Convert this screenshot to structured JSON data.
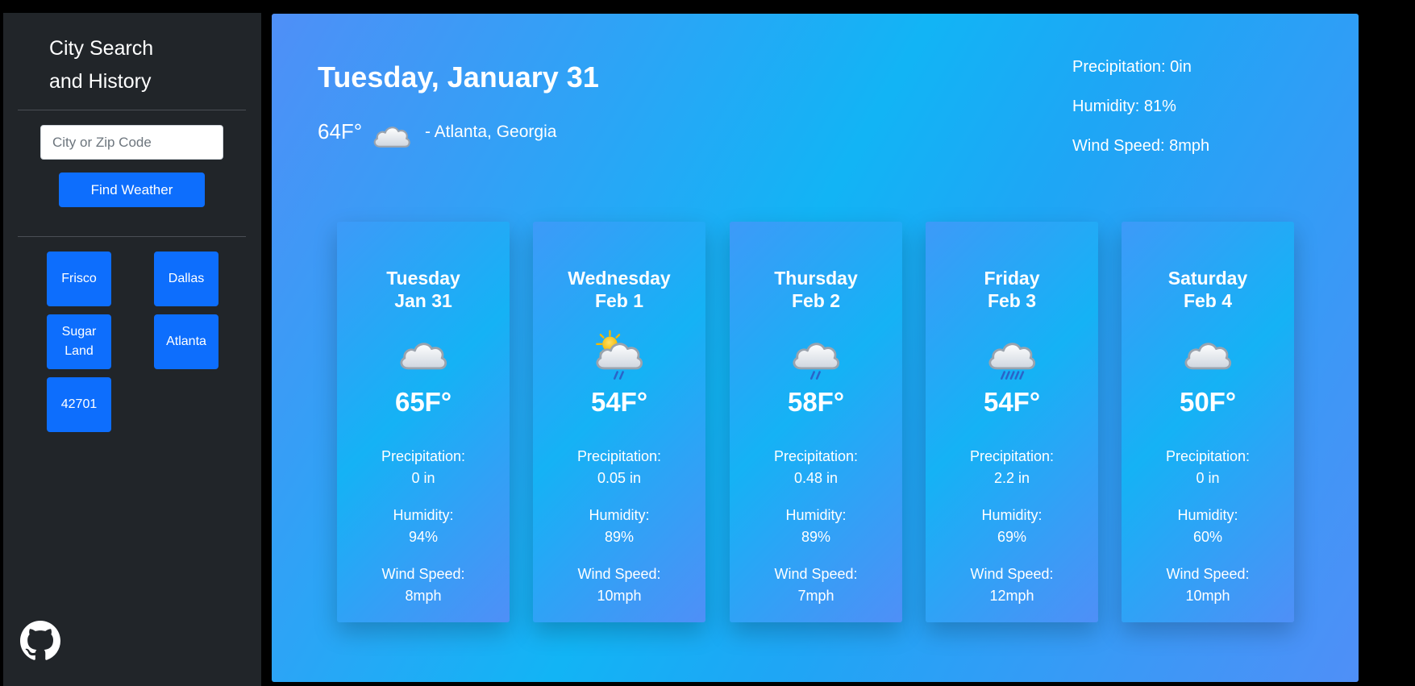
{
  "sidebar": {
    "title_line1": "City Search",
    "title_line2": "and History",
    "search_placeholder": "City or Zip Code",
    "find_button": "Find Weather",
    "history": [
      "Frisco",
      "Dallas",
      "Sugar Land",
      "Atlanta",
      "42701"
    ],
    "github_icon": "github-icon"
  },
  "current": {
    "date": "Tuesday, January 31",
    "temp": "64F°",
    "icon": "cloud-icon",
    "location": "- Atlanta, Georgia",
    "precipitation": "Precipitation: 0in",
    "humidity": "Humidity: 81%",
    "wind": "Wind Speed: 8mph"
  },
  "forecast": [
    {
      "day": "Tuesday",
      "date": "Jan 31",
      "icon": "cloud-icon",
      "temp": "65F°",
      "precip_label": "Precipitation:",
      "precip": "0 in",
      "humidity_label": "Humidity:",
      "humidity": "94%",
      "wind_label": "Wind Speed:",
      "wind": "8mph"
    },
    {
      "day": "Wednesday",
      "date": "Feb 1",
      "icon": "sun-cloud-rain-icon",
      "temp": "54F°",
      "precip_label": "Precipitation:",
      "precip": "0.05 in",
      "humidity_label": "Humidity:",
      "humidity": "89%",
      "wind_label": "Wind Speed:",
      "wind": "10mph"
    },
    {
      "day": "Thursday",
      "date": "Feb 2",
      "icon": "cloud-light-rain-icon",
      "temp": "58F°",
      "precip_label": "Precipitation:",
      "precip": "0.48 in",
      "humidity_label": "Humidity:",
      "humidity": "89%",
      "wind_label": "Wind Speed:",
      "wind": "7mph"
    },
    {
      "day": "Friday",
      "date": "Feb 3",
      "icon": "cloud-heavy-rain-icon",
      "temp": "54F°",
      "precip_label": "Precipitation:",
      "precip": "2.2 in",
      "humidity_label": "Humidity:",
      "humidity": "69%",
      "wind_label": "Wind Speed:",
      "wind": "12mph"
    },
    {
      "day": "Saturday",
      "date": "Feb 4",
      "icon": "cloud-icon",
      "temp": "50F°",
      "precip_label": "Precipitation:",
      "precip": "0 in",
      "humidity_label": "Humidity:",
      "humidity": "60%",
      "wind_label": "Wind Speed:",
      "wind": "10mph"
    }
  ]
}
